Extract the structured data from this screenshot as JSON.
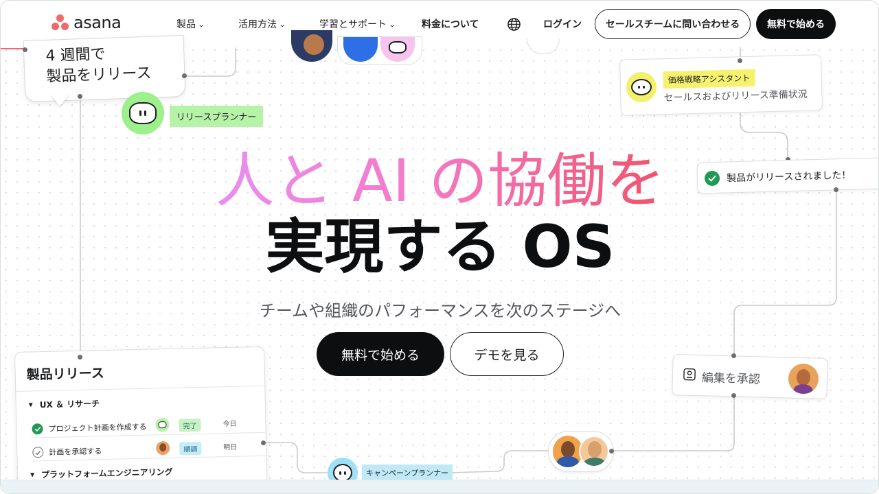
{
  "nav": {
    "logo_text": "asana",
    "items": [
      {
        "label": "製品",
        "has_dropdown": true
      },
      {
        "label": "活用方法",
        "has_dropdown": true
      },
      {
        "label": "学習とサポート",
        "has_dropdown": true
      },
      {
        "label": "料金について",
        "has_dropdown": false
      }
    ],
    "globe_icon": "globe-icon",
    "login_label": "ログイン",
    "contact_label": "セールスチームに問い合わせる",
    "start_label": "無料で始める"
  },
  "hero": {
    "headline_line1": "人と AI の協働を",
    "headline_line2": "実現する OS",
    "subtitle": "チームや組織のパフォーマンスを次のステージへ",
    "cta_primary": "無料で始める",
    "cta_secondary": "デモを見る"
  },
  "bubble": {
    "text": "4 週間で\n製品をリリース"
  },
  "release_planner": {
    "label": "リリースプランナー"
  },
  "pricing_card": {
    "tag": "価格戦略アシスタント",
    "text": "セールスおよびリリース準備状況"
  },
  "released_card": {
    "text": "製品がリリースされました！"
  },
  "approve_card": {
    "text": "編集を承認"
  },
  "campaign_planner": {
    "label": "キャンペーンプランナー"
  },
  "panel": {
    "title": "製品リリース",
    "sections": [
      {
        "title": "UX ＆ リサーチ",
        "tasks": [
          {
            "name": "プロジェクト計画を作成する",
            "status": "完了",
            "due": "今日",
            "done": true
          },
          {
            "name": "計画を承認する",
            "status": "順調",
            "due": "明日",
            "done": false
          }
        ]
      },
      {
        "title": "プラットフォームエンジニアリング",
        "tasks": []
      }
    ]
  },
  "colors": {
    "brand_coral": "#f06a6a",
    "black": "#0d0e10",
    "green_chip": "#b6f2a8",
    "yellow_tag": "#f6f26f",
    "blue_chip": "#bfe9f7",
    "status_done_bg": "#c9f0c8",
    "status_ontrack_bg": "#c5ecfa"
  }
}
